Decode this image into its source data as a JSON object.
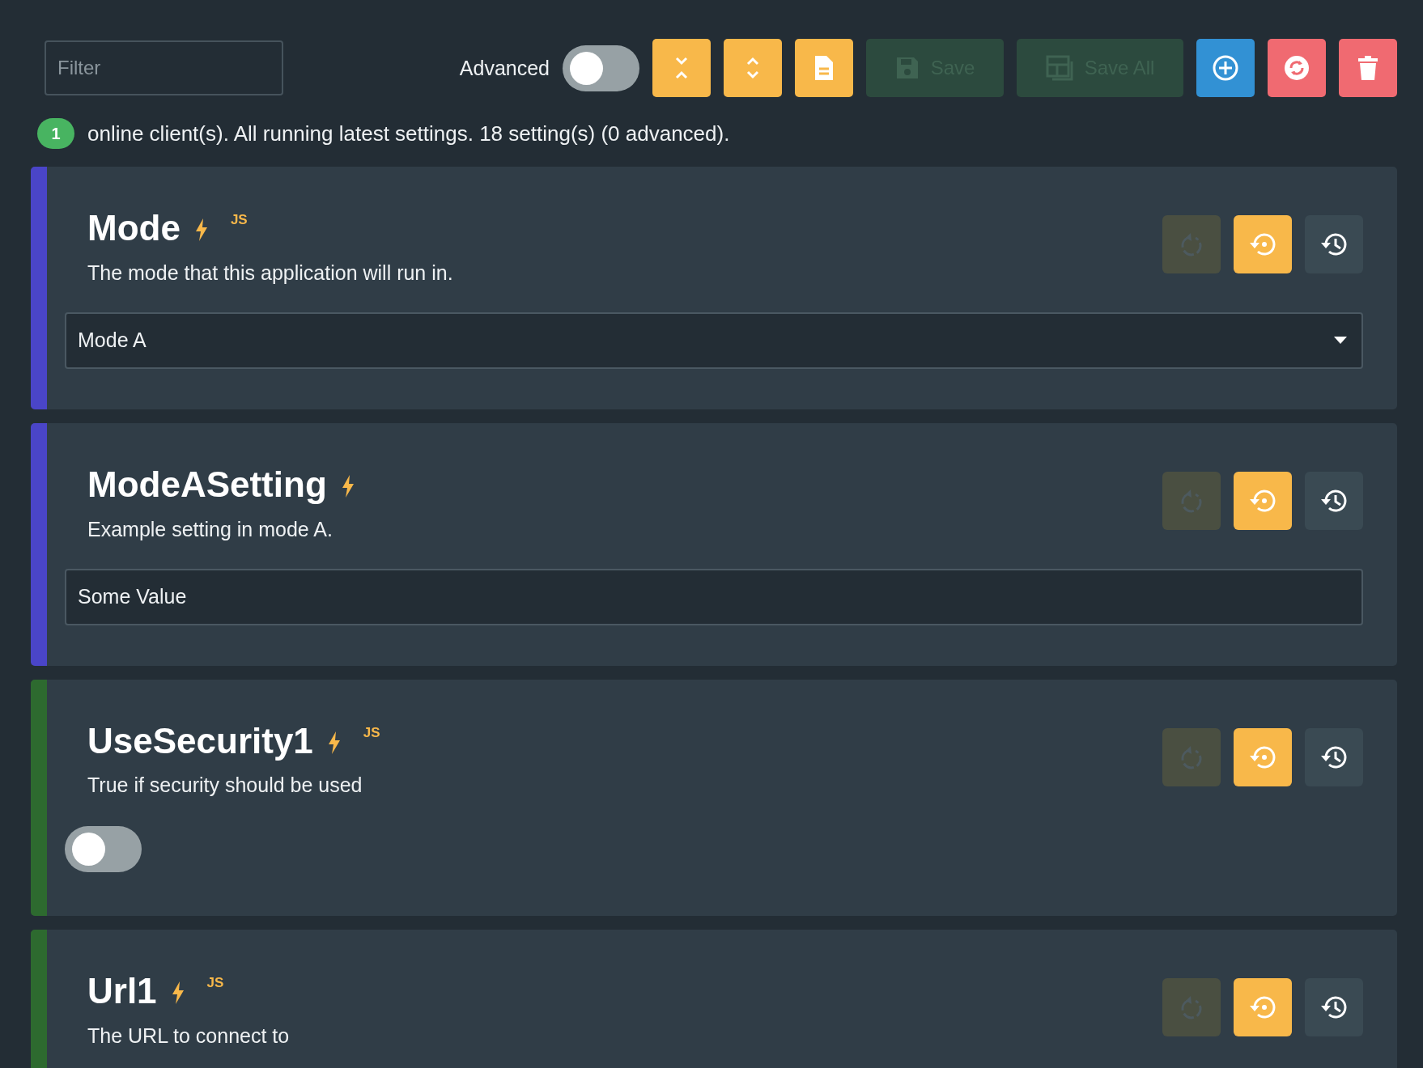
{
  "toolbar": {
    "filter": {
      "placeholder": "Filter"
    },
    "advanced": {
      "label": "Advanced",
      "on": false
    },
    "buttons": [
      {
        "kind": "collapse",
        "disabled": false
      },
      {
        "kind": "expand",
        "disabled": false
      },
      {
        "kind": "document",
        "disabled": false
      },
      {
        "kind": "save",
        "label": "Save",
        "disabled": true
      },
      {
        "kind": "save-all",
        "label": "Save All",
        "disabled": true
      },
      {
        "kind": "add",
        "disabled": false
      },
      {
        "kind": "sync",
        "disabled": false
      },
      {
        "kind": "delete",
        "disabled": false
      }
    ]
  },
  "status": {
    "count": "1",
    "text": "online client(s). All running latest settings. 18 setting(s) (0 advanced)."
  },
  "settings": [
    {
      "title": "Mode",
      "badge": "JS",
      "color": "#4a45c8",
      "description": "The mode that this application will run in.",
      "undo_disabled": true,
      "control": {
        "kind": "select",
        "value": "Mode A"
      }
    },
    {
      "title": "ModeASetting",
      "color": "#4a45c8",
      "description": "Example setting in mode A.",
      "undo_disabled": true,
      "control": {
        "kind": "text",
        "value": "Some Value"
      }
    },
    {
      "title": "UseSecurity1",
      "badge": "JS",
      "color": "#2d6a2f",
      "description": "True if security should be used",
      "undo_disabled": true,
      "control": {
        "kind": "toggle",
        "on": false
      }
    },
    {
      "title": "Url1",
      "badge": "JS",
      "color": "#2d6a2f",
      "description": "The URL to connect to",
      "undo_disabled": true
    }
  ]
}
